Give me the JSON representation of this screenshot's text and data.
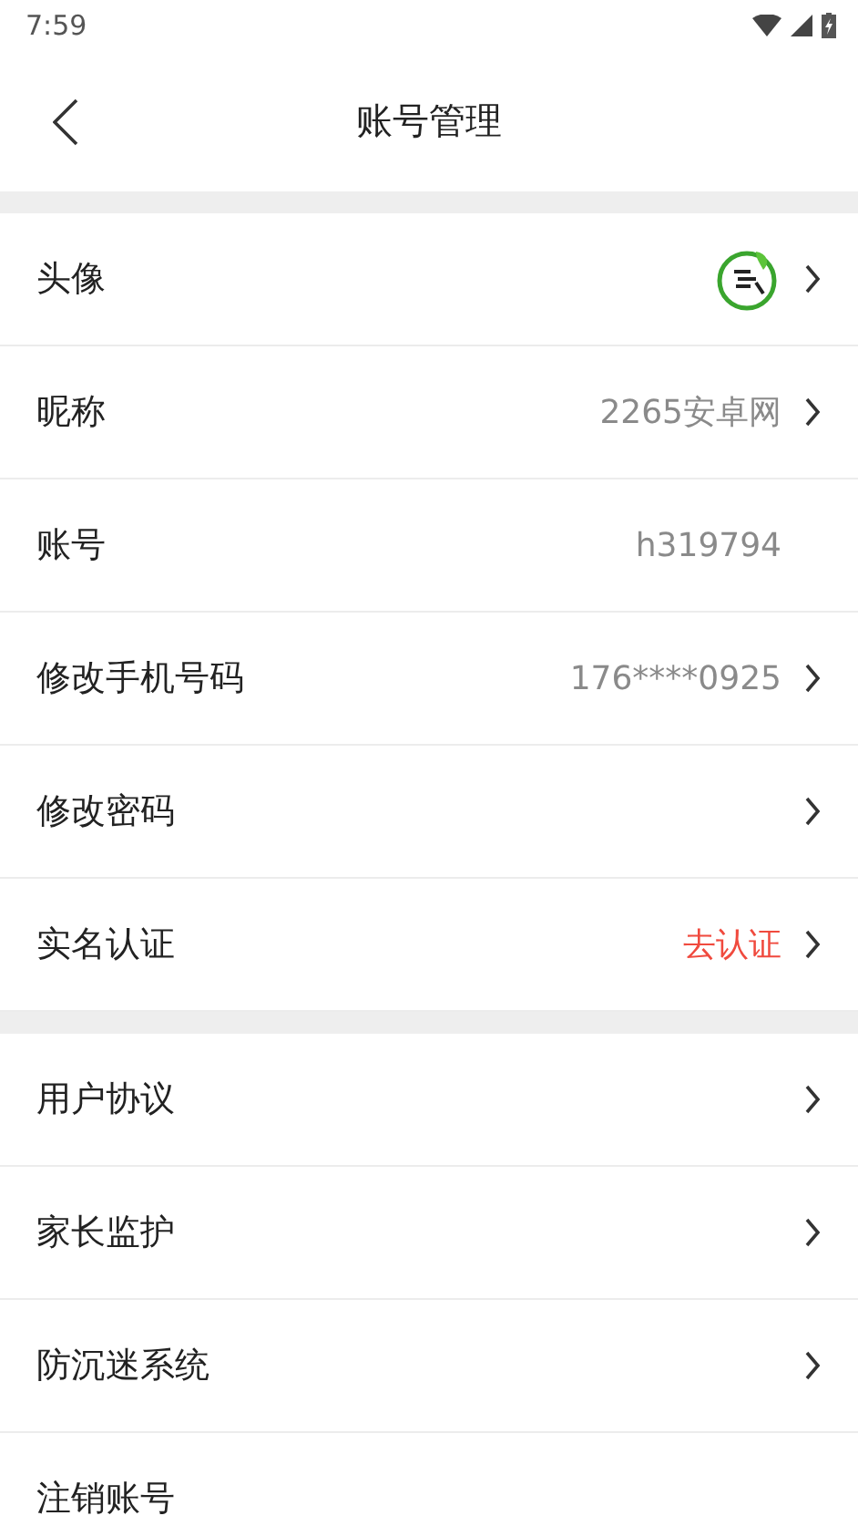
{
  "status_bar": {
    "time": "7:59"
  },
  "header": {
    "title": "账号管理"
  },
  "sections": [
    {
      "rows": [
        {
          "kind": "avatar",
          "label": "头像",
          "chevron": true
        },
        {
          "kind": "value",
          "label": "昵称",
          "value": "2265安卓网",
          "highlight": false,
          "chevron": true
        },
        {
          "kind": "value",
          "label": "账号",
          "value": "h319794",
          "highlight": false,
          "chevron": false
        },
        {
          "kind": "value",
          "label": "修改手机号码",
          "value": "176****0925",
          "highlight": false,
          "chevron": true
        },
        {
          "kind": "plain",
          "label": "修改密码",
          "chevron": true
        },
        {
          "kind": "value",
          "label": "实名认证",
          "value": "去认证",
          "highlight": true,
          "chevron": true
        }
      ]
    },
    {
      "rows": [
        {
          "kind": "plain",
          "label": "用户协议",
          "chevron": true
        },
        {
          "kind": "plain",
          "label": "家长监护",
          "chevron": true
        },
        {
          "kind": "plain",
          "label": "防沉迷系统",
          "chevron": true
        },
        {
          "kind": "plain",
          "label": "注销账号",
          "chevron": false
        }
      ]
    }
  ]
}
